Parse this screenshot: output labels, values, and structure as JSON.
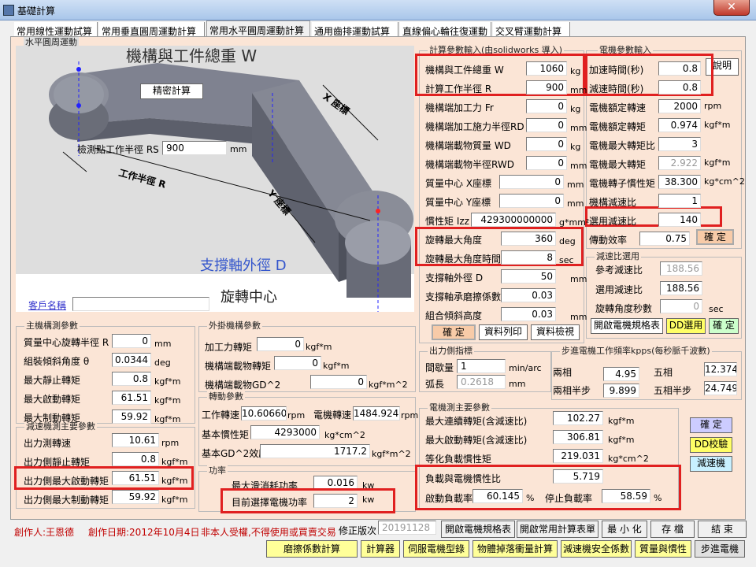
{
  "window": {
    "title": "基礎計算",
    "close": "✕"
  },
  "tabs": [
    "常用線性運動試算",
    "常用垂直圓周運動計算",
    "常用水平圓周運動計算",
    "通用齒排運動試算",
    "直線偏心輪往復運動",
    "交叉臂運動計算"
  ],
  "active_tab": 2,
  "diagram": {
    "group_title": "水平圓周運動",
    "weight_title": "機構與工件總重 W",
    "precise_btn": "精密計算",
    "rs_label": "檢測點工作半徑 RS",
    "rs_value": "900",
    "rs_unit": "mm",
    "x_axis": "X 座標",
    "y_axis": "Y 座標",
    "radius_label": "工作半徑 R",
    "support_label": "支撐軸外徑 D",
    "rotate_center": "旋轉中心",
    "customer_label": "客戶名稱",
    "customer_value": ""
  },
  "calc_params": {
    "title": "計算參數輸入(由solidworks 導入)",
    "rows": [
      {
        "label": "機構與工件總重 W",
        "value": "1060",
        "unit": "kg"
      },
      {
        "label": "計算工作半徑 R",
        "value": "900",
        "unit": "mm"
      },
      {
        "label": "機構端加工力 Fr",
        "value": "0",
        "unit": "kg"
      },
      {
        "label": "機構端加工施力半徑RD",
        "value": "0",
        "unit": "mm"
      },
      {
        "label": "機構端載物質量 WD",
        "value": "0",
        "unit": "kg"
      },
      {
        "label": "機構端載物半徑RWD",
        "value": "0",
        "unit": "mm"
      },
      {
        "label": "質量中心 X座標",
        "value": "0",
        "unit": "mm"
      },
      {
        "label": "質量中心 Y座標",
        "value": "0",
        "unit": "mm"
      },
      {
        "label": "慣性矩 Izz",
        "value": "429300000000",
        "unit": "g*mm²"
      },
      {
        "label": "旋轉最大角度",
        "value": "360",
        "unit": "deg"
      },
      {
        "label": "旋轉最大角度時間",
        "value": "8",
        "unit": "sec"
      },
      {
        "label": "支撐軸外徑 D",
        "value": "50",
        "unit": "mm"
      },
      {
        "label": "支撐軸承磨擦係數",
        "value": "0.03",
        "unit": ""
      },
      {
        "label": "組合傾斜高度",
        "value": "0.03",
        "unit": "mm"
      }
    ],
    "confirm": "確 定",
    "list_print": "資料列印",
    "list_view": "資料檢視"
  },
  "motor_params": {
    "title": "電機參數輸入",
    "explain": "說明",
    "rows": [
      {
        "label": "加速時間(秒)",
        "value": "0.8",
        "unit": "",
        "dis": false
      },
      {
        "label": "減速時間(秒)",
        "value": "0.8",
        "unit": "",
        "dis": false
      },
      {
        "label": "電機額定轉速",
        "value": "2000",
        "unit": "rpm",
        "dis": false
      },
      {
        "label": "電機額定轉矩",
        "value": "0.974",
        "unit": "kgf*m",
        "dis": false
      },
      {
        "label": "電機最大轉矩比",
        "value": "3",
        "unit": "",
        "dis": false
      },
      {
        "label": "電機最大轉矩",
        "value": "2.922",
        "unit": "kgf*m",
        "dis": true
      },
      {
        "label": "電機轉子慣性矩",
        "value": "38.300",
        "unit": "kg*cm^2",
        "dis": false
      },
      {
        "label": "機構減速比",
        "value": "1",
        "unit": "",
        "dis": false
      },
      {
        "label": "選用減速比",
        "value": "140",
        "unit": "",
        "dis": false
      },
      {
        "label": "傳動效率",
        "value": "0.75",
        "unit": "",
        "dis": false
      }
    ],
    "confirm": "確 定"
  },
  "reducer": {
    "title": "減速比選用",
    "ref_label": "參考減速比",
    "ref_value": "188.56",
    "sel_label": "選用減速比",
    "sel_value": "188.56",
    "angle_label": "旋轉角度秒數",
    "angle_value": "0",
    "angle_unit": "sec",
    "open_btn": "開啟電機規格表",
    "dd_btn": "DD選用",
    "confirm": "確 定"
  },
  "main_mech": {
    "title": "主機構測參數",
    "rows": [
      {
        "label": "質量中心旋轉半徑 R",
        "value": "0",
        "unit": "mm"
      },
      {
        "label": "組裝傾斜角度 θ",
        "value": "0.0344",
        "unit": "deg"
      },
      {
        "label": "最大靜止轉矩",
        "value": "0.8",
        "unit": "kgf*m"
      },
      {
        "label": "最大啟動轉矩",
        "value": "61.51",
        "unit": "kgf*m"
      },
      {
        "label": "最大制動轉矩",
        "value": "59.92",
        "unit": "kgf*m"
      }
    ]
  },
  "reducer_main": {
    "title": "減速機測主要參數",
    "rows": [
      {
        "label": "出力測轉速",
        "value": "10.61",
        "unit": "rpm"
      },
      {
        "label": "出力側靜止轉矩",
        "value": "0.8",
        "unit": "kgf*m"
      },
      {
        "label": "出力側最大啟動轉矩",
        "value": "61.51",
        "unit": "kgf*m"
      },
      {
        "label": "出力側最大制動轉矩",
        "value": "59.92",
        "unit": "kgf*m"
      }
    ]
  },
  "external": {
    "title": "外掛機構參數",
    "rows": [
      {
        "label": "加工力轉矩",
        "value": "0",
        "unit": "kgf*m"
      },
      {
        "label": "機構端載物轉矩",
        "value": "0",
        "unit": "kgf*m"
      },
      {
        "label": "機構端載物GD^2",
        "value": "0",
        "unit": "kgf*m^2"
      }
    ]
  },
  "rotation": {
    "title": "轉動參數",
    "work_speed_label": "工作轉速",
    "work_speed": "10.606602",
    "work_unit": "rpm",
    "motor_speed_label": "電機轉速",
    "motor_speed": "1484.924",
    "motor_unit": "rpm",
    "inertia_label": "基本慣性矩",
    "inertia": "4293000",
    "inertia_unit": "kg*cm^2",
    "gd_label": "基本GD^2效應",
    "gd": "1717.2",
    "gd_unit": "kgf*m^2"
  },
  "power": {
    "title": "功率",
    "max_label": "最大滑消耗功率",
    "max_value": "0.016",
    "max_unit": "kw",
    "cur_label": "目前選擇電機功率",
    "cur_value": "2",
    "cur_unit": "kw"
  },
  "output_idx": {
    "title": "出力側指標",
    "interval_label": "間歇量",
    "interval_value": "1",
    "interval_unit": "min/arc",
    "arc_label": "弧長",
    "arc_value": "0.2618",
    "arc_unit": "mm"
  },
  "stepper": {
    "title": "步進電機工作頻率kpps(每秒脈千波數)",
    "two": "兩相",
    "two_value": "4.95",
    "five": "五相",
    "five_value": "12.374",
    "two_half": "兩相半步",
    "two_half_value": "9.899",
    "five_half": "五相半步",
    "five_half_value": "24.749"
  },
  "motor_main": {
    "title": "電機測主要參數",
    "rows": [
      {
        "label": "最大連續轉矩(含減速比)",
        "value": "102.27",
        "unit": "kgf*m"
      },
      {
        "label": "最大啟動轉矩(含減速比)",
        "value": "306.81",
        "unit": "kgf*m"
      },
      {
        "label": "等化負載慣性矩",
        "value": "219.031",
        "unit": "kg*cm^2"
      }
    ],
    "ratio_label": "負載與電機慣性比",
    "ratio_value": "5.719",
    "start_label": "啟動負載率",
    "start_value": "60.145",
    "start_unit": "%",
    "stop_label": "停止負載率",
    "stop_value": "58.59",
    "stop_unit": "%"
  },
  "side_btns": {
    "confirm": "確 定",
    "dd": "DD校驗",
    "reducer": "減速機"
  },
  "footer": {
    "author": "創作人:王恩德",
    "date": "創作日期:2012年10月4日",
    "notice": "非本人受權,不得使用或買賣交易",
    "ver_label": "修正版次",
    "ver_value": "20191128",
    "row1": [
      "開啟電機規格表",
      "開啟常用計算表單",
      "最 小 化",
      "存 檔",
      "結 束"
    ],
    "row2": [
      "磨擦係數計算",
      "計算器",
      "伺服電機型錄",
      "物體掉落衝量計算",
      "減速機安全係數",
      "質量與慣性",
      "步進電機"
    ]
  },
  "accent": {
    "highlight": "#e02020",
    "panel": "#fbe5d6"
  }
}
